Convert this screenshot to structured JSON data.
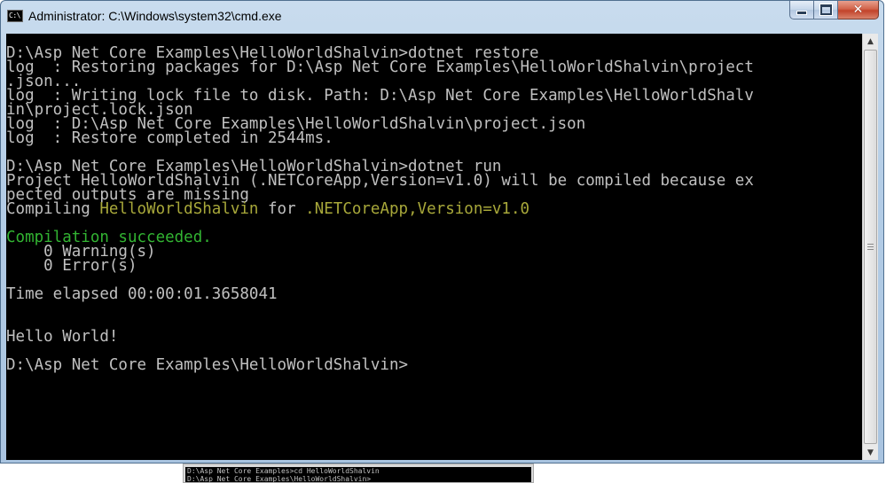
{
  "window": {
    "title": "Administrator: C:\\Windows\\system32\\cmd.exe",
    "app_icon_text": "C:\\",
    "buttons": {
      "minimize": "minimize-icon",
      "maximize": "maximize-icon",
      "close": "close-icon"
    }
  },
  "console": {
    "lines": [
      {
        "text": "D:\\Asp Net Core Examples\\HelloWorldShalvin>dotnet restore"
      },
      {
        "text": "log  : Restoring packages for D:\\Asp Net Core Examples\\HelloWorldShalvin\\project"
      },
      {
        "text": ".json..."
      },
      {
        "text": "log  : Writing lock file to disk. Path: D:\\Asp Net Core Examples\\HelloWorldShalv"
      },
      {
        "text": "in\\project.lock.json"
      },
      {
        "text": "log  : D:\\Asp Net Core Examples\\HelloWorldShalvin\\project.json"
      },
      {
        "text": "log  : Restore completed in 2544ms."
      },
      {
        "text": ""
      },
      {
        "text": "D:\\Asp Net Core Examples\\HelloWorldShalvin>dotnet run"
      },
      {
        "text": "Project HelloWorldShalvin (.NETCoreApp,Version=v1.0) will be compiled because ex"
      },
      {
        "text": "pected outputs are missing"
      },
      {
        "compile": {
          "prefix": "Compiling ",
          "project": "HelloWorldShalvin",
          "middle": " for ",
          "framework": ".NETCoreApp,Version=v1.0"
        }
      },
      {
        "text": ""
      },
      {
        "success": "Compilation succeeded."
      },
      {
        "text": "    0 Warning(s)"
      },
      {
        "text": "    0 Error(s)"
      },
      {
        "text": ""
      },
      {
        "text": "Time elapsed 00:00:01.3658041"
      },
      {
        "text": ""
      },
      {
        "text": ""
      },
      {
        "text": "Hello World!"
      },
      {
        "text": ""
      },
      {
        "text": "D:\\Asp Net Core Examples\\HelloWorldShalvin>"
      }
    ]
  },
  "background_window": {
    "line1": "D:\\Asp Net Core Examples>cd HelloWorldShalvin",
    "line2": "D:\\Asp Net Core Examples\\HelloWorldShalvin>"
  },
  "colors": {
    "console_bg": "#000000",
    "console_text": "#c0c0c0",
    "success_green": "#32b432",
    "highlight_olive": "#a8a83a"
  }
}
